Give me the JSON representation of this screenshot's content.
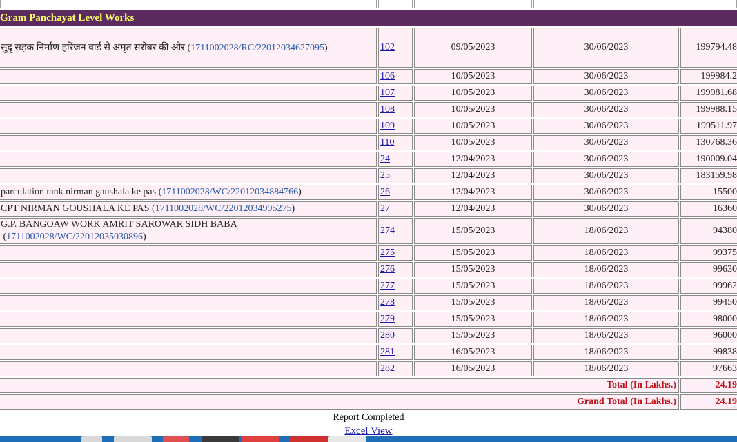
{
  "section_title": "Gram Panchayat Level Works",
  "rows": [
    {
      "desc": "सुदृ सड़क निर्माण हरिजन वार्ड से अमृत सरोबर की ओर",
      "code": "1711002028/RC/22012034627095",
      "id": "102",
      "start": "09/05/2023",
      "end": "30/06/2023",
      "amount": "199794.48"
    },
    {
      "desc": "",
      "code": "",
      "id": "106",
      "start": "10/05/2023",
      "end": "30/06/2023",
      "amount": "199984.2"
    },
    {
      "desc": "",
      "code": "",
      "id": "107",
      "start": "10/05/2023",
      "end": "30/06/2023",
      "amount": "199981.68"
    },
    {
      "desc": "",
      "code": "",
      "id": "108",
      "start": "10/05/2023",
      "end": "30/06/2023",
      "amount": "199988.15"
    },
    {
      "desc": "",
      "code": "",
      "id": "109",
      "start": "10/05/2023",
      "end": "30/06/2023",
      "amount": "199511.97"
    },
    {
      "desc": "",
      "code": "",
      "id": "110",
      "start": "10/05/2023",
      "end": "30/06/2023",
      "amount": "130768.36"
    },
    {
      "desc": "",
      "code": "",
      "id": "24",
      "start": "12/04/2023",
      "end": "30/06/2023",
      "amount": "190009.04"
    },
    {
      "desc": "",
      "code": "",
      "id": "25",
      "start": "12/04/2023",
      "end": "30/06/2023",
      "amount": "183159.98"
    },
    {
      "desc": "parculation tank nirman gaushala ke pas",
      "code": "1711002028/WC/22012034884766",
      "id": "26",
      "start": "12/04/2023",
      "end": "30/06/2023",
      "amount": "15500"
    },
    {
      "desc": "CPT NIRMAN GOUSHALA KE PAS",
      "code": "1711002028/WC/22012034995275",
      "id": "27",
      "start": "12/04/2023",
      "end": "30/06/2023",
      "amount": "16360"
    },
    {
      "desc": "G.P. BANGOAW WORK AMRIT SAROWAR SIDH BABA",
      "code": "1711002028/WC/22012035030896",
      "id": "274",
      "start": "15/05/2023",
      "end": "18/06/2023",
      "amount": "94380"
    },
    {
      "desc": "",
      "code": "",
      "id": "275",
      "start": "15/05/2023",
      "end": "18/06/2023",
      "amount": "99375"
    },
    {
      "desc": "",
      "code": "",
      "id": "276",
      "start": "15/05/2023",
      "end": "18/06/2023",
      "amount": "99630"
    },
    {
      "desc": "",
      "code": "",
      "id": "277",
      "start": "15/05/2023",
      "end": "18/06/2023",
      "amount": "99962"
    },
    {
      "desc": "",
      "code": "",
      "id": "278",
      "start": "15/05/2023",
      "end": "18/06/2023",
      "amount": "99450"
    },
    {
      "desc": "",
      "code": "",
      "id": "279",
      "start": "15/05/2023",
      "end": "18/06/2023",
      "amount": "98000"
    },
    {
      "desc": "",
      "code": "",
      "id": "280",
      "start": "15/05/2023",
      "end": "18/06/2023",
      "amount": "96000"
    },
    {
      "desc": "",
      "code": "",
      "id": "281",
      "start": "16/05/2023",
      "end": "18/06/2023",
      "amount": "99838"
    },
    {
      "desc": "",
      "code": "",
      "id": "282",
      "start": "16/05/2023",
      "end": "18/06/2023",
      "amount": "97663"
    }
  ],
  "totals": {
    "total_label": "Total (In Lakhs.)",
    "total_value": "24.19",
    "grand_label": "Grand Total (In Lakhs.)",
    "grand_value": "24.19"
  },
  "footer": {
    "report_status": "Report Completed",
    "excel_link": "Excel View"
  }
}
